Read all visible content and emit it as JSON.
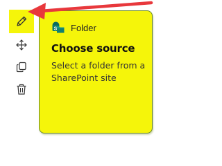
{
  "toolbar": {
    "items": [
      {
        "icon": "pencil-icon",
        "label": "Edit",
        "selected": true
      },
      {
        "icon": "move-icon",
        "label": "Move"
      },
      {
        "icon": "duplicate-icon",
        "label": "Duplicate"
      },
      {
        "icon": "trash-icon",
        "label": "Delete"
      }
    ]
  },
  "card": {
    "type_label": "Folder",
    "type_icon": "sharepoint-folder-icon",
    "title": "Choose source",
    "description": "Select a folder from a SharePoint site"
  },
  "annotation": {
    "icon": "red-arrow-icon",
    "color": "#e8383c"
  },
  "colors": {
    "highlight": "#f5f50a",
    "card_border": "#6a8a2a",
    "sharepoint": "#0f7b6c"
  }
}
